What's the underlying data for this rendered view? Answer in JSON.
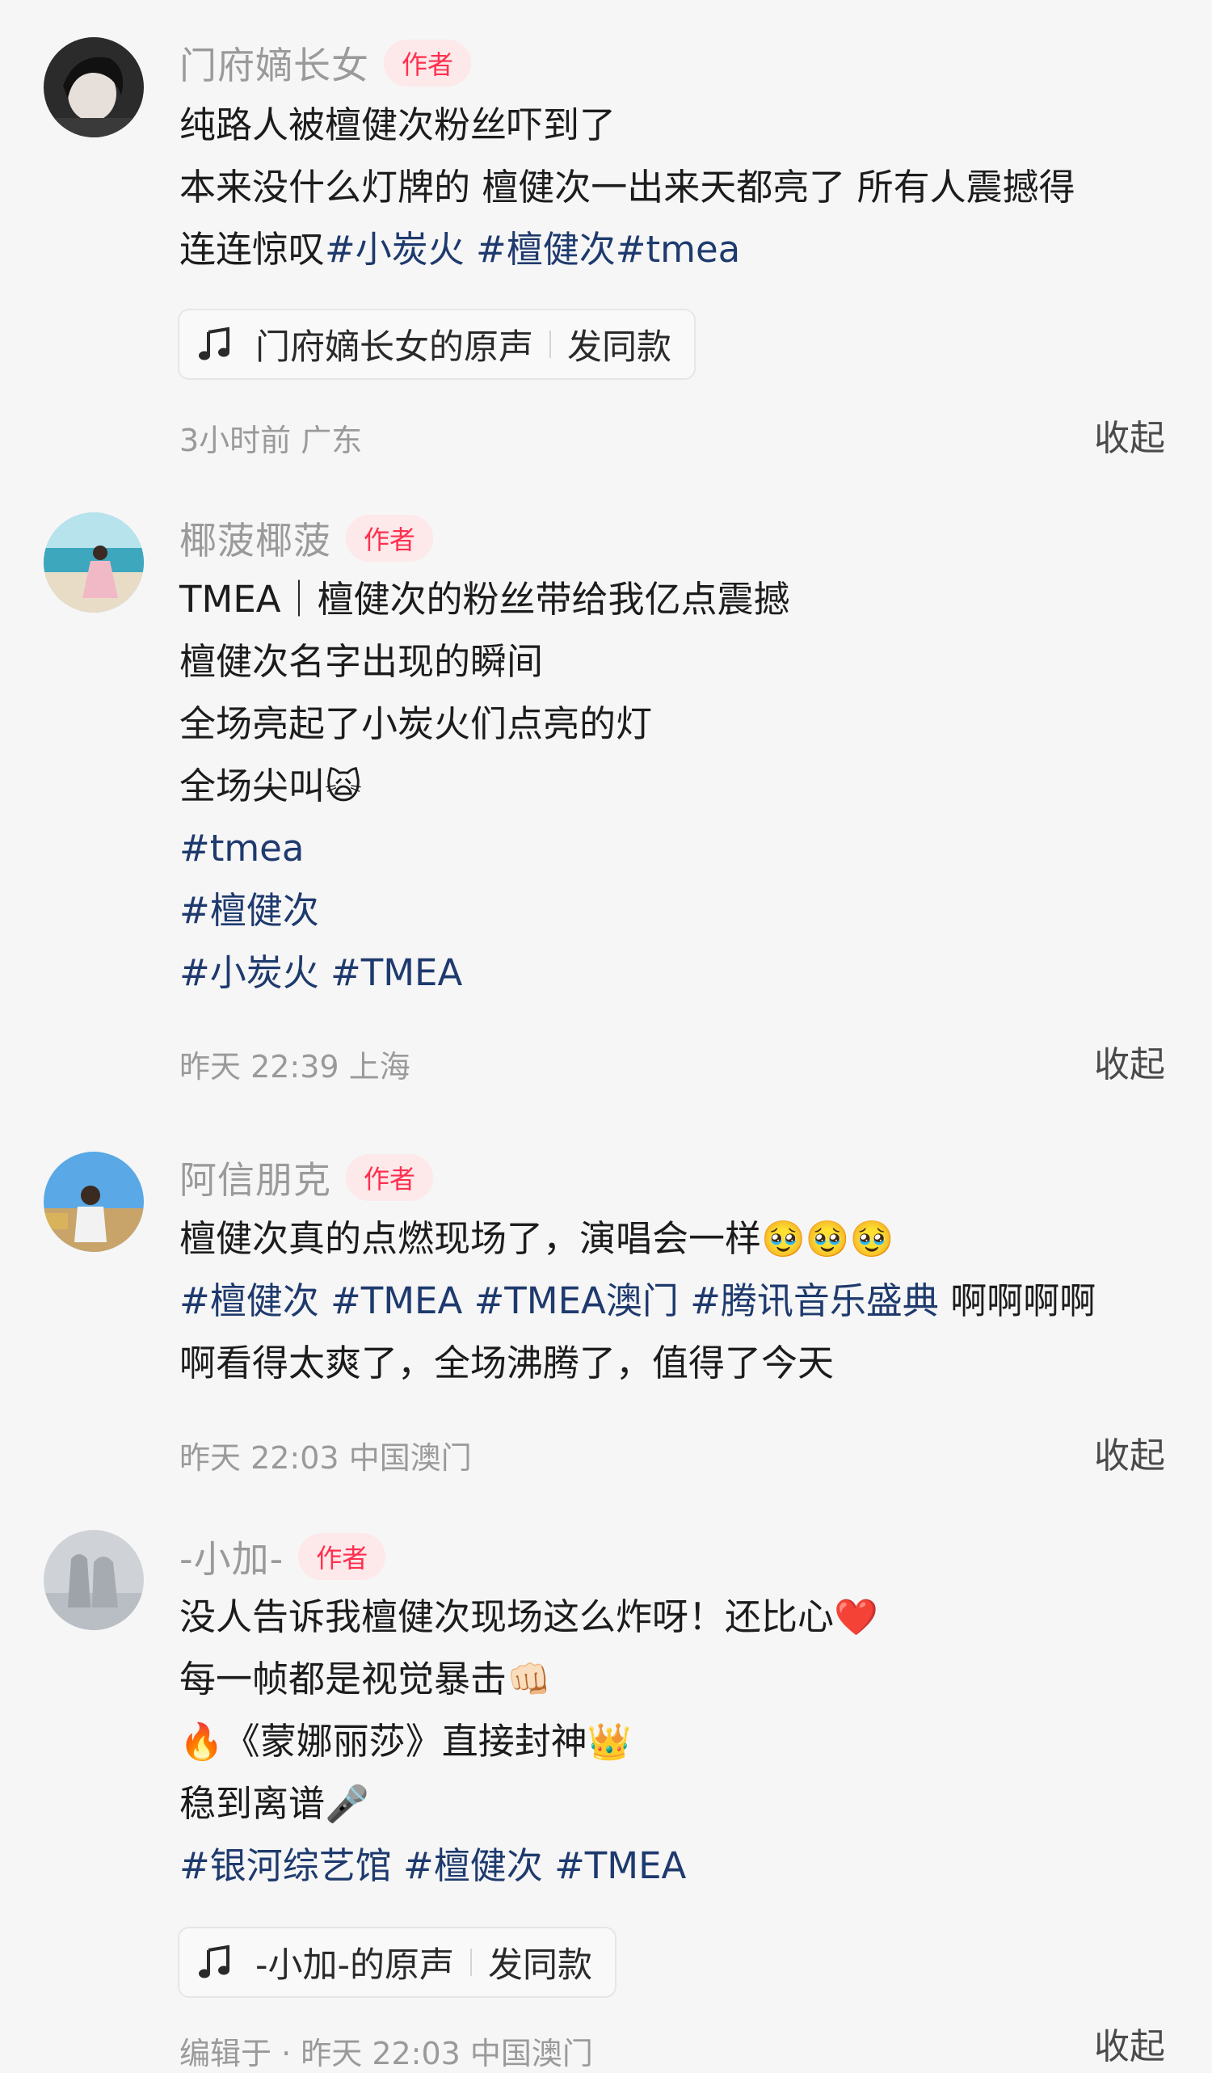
{
  "posts": [
    {
      "author": "门府嫡长女",
      "author_tag": "作者",
      "lines": [
        "纯路人被檀健次粉丝吓到了",
        "本来没什么灯牌的 檀健次一出来天都亮了 所有人震撼得",
        "连连惊叹"
      ],
      "line3_tags": [
        "#小炭火",
        "#檀健次",
        "#tmea"
      ],
      "music_label": "门府嫡长女的原声",
      "music_action": "发同款",
      "time": "3小时前",
      "location": "广东",
      "collapse": "收起"
    },
    {
      "author": "椰菠椰菠",
      "author_tag": "作者",
      "lines": [
        "TMEA｜檀健次的粉丝带给我亿点震撼",
        "檀健次名字出现的瞬间",
        "全场亮起了小炭火们点亮的灯",
        "全场尖叫"
      ],
      "emoji": "🙀",
      "hashtags": [
        "#tmea",
        "#檀健次",
        "#小炭火",
        "#TMEA"
      ],
      "time": "昨天 22:39",
      "location": "上海",
      "collapse": "收起"
    },
    {
      "author": "阿信朋克",
      "author_tag": "作者",
      "line1": "檀健次真的点燃现场了，演唱会一样",
      "emoji": "🥹🥹🥹",
      "hashtags": [
        "#檀健次",
        "#TMEA",
        "#TMEA澳门",
        "#腾讯音乐盛典"
      ],
      "line2_tail": "啊啊啊啊",
      "line3": "啊看得太爽了，全场沸腾了，值得了今天",
      "time": "昨天 22:03",
      "location": "中国澳门",
      "collapse": "收起"
    },
    {
      "author": "-小加-",
      "author_tag": "作者",
      "lines": [
        "没人告诉我檀健次现场这么炸呀！还比心",
        "每一帧都是视觉暴击",
        "《蒙娜丽莎》直接封神",
        "稳到离谱"
      ],
      "emojis": [
        "❤️",
        "👊🏻",
        "🔥",
        "👑",
        "🎤"
      ],
      "hashtags": [
        "#银河综艺馆",
        "#檀健次",
        "#TMEA"
      ],
      "music_label": "-小加-的原声",
      "music_action": "发同款",
      "partial_meta": "编辑于 · 昨天 22:03 中国澳门",
      "collapse": "收起"
    }
  ],
  "colors": {
    "hashtag": "#1e3a6e",
    "tag_bg": "#fde8ea",
    "tag_text": "#ff2f4e",
    "meta": "#9a9a9a"
  },
  "icons": {
    "music": "music-note-icon"
  }
}
